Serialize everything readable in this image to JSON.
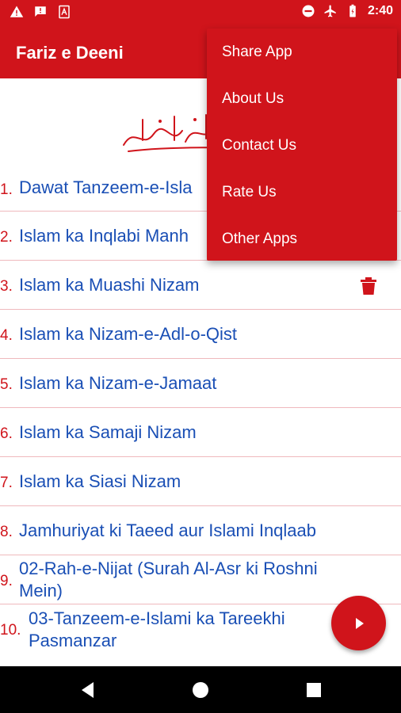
{
  "status_bar": {
    "time": "2:40",
    "left_icons": [
      "warning-icon",
      "chat-alert-icon",
      "app-notification-icon"
    ],
    "right_icons": [
      "do-not-disturb-icon",
      "airplane-icon",
      "battery-icon"
    ]
  },
  "app_bar": {
    "title": "Fariz e Deeni"
  },
  "menu": {
    "items": [
      {
        "label": "Share App"
      },
      {
        "label": "About Us"
      },
      {
        "label": "Contact Us"
      },
      {
        "label": "Rate Us"
      },
      {
        "label": "Other Apps"
      }
    ]
  },
  "list": {
    "items": [
      {
        "number": "1.",
        "title": "Dawat Tanzeem-e-Isla"
      },
      {
        "number": "2.",
        "title": "Islam ka Inqlabi Manh"
      },
      {
        "number": "3.",
        "title": "Islam ka Muashi Nizam"
      },
      {
        "number": "4.",
        "title": "Islam ka Nizam-e-Adl-o-Qist"
      },
      {
        "number": "5.",
        "title": "Islam ka Nizam-e-Jamaat"
      },
      {
        "number": "6.",
        "title": "Islam ka Samaji Nizam"
      },
      {
        "number": "7.",
        "title": "Islam ka Siasi Nizam"
      },
      {
        "number": "8.",
        "title": "Jamhuriyat ki Taeed aur Islami Inqlaab"
      },
      {
        "number": "9.",
        "title": "02-Rah-e-Nijat (Surah Al-Asr ki Roshni Mein)"
      },
      {
        "number": "10.",
        "title": "03-Tanzeem-e-Islami ka Tareekhi Pasmanzar"
      }
    ]
  },
  "colors": {
    "primary": "#d0141b",
    "link": "#1a4fb5",
    "divider": "#efb9bd"
  }
}
